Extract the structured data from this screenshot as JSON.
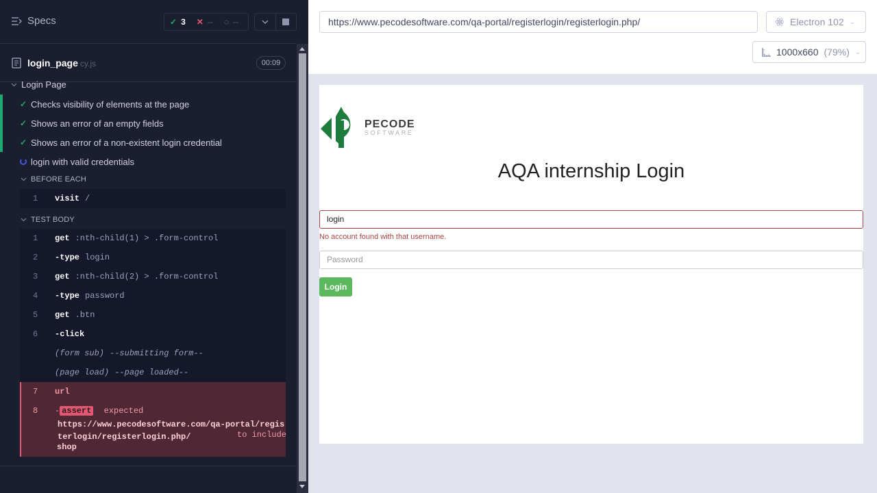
{
  "reporter": {
    "specs_label": "Specs",
    "stats": {
      "passed": "3",
      "failed": "--",
      "pending": "--"
    },
    "spec": {
      "name": "login_page",
      "ext": "cy.js",
      "duration": "00:09"
    },
    "suite_title": "Login Page",
    "tests": [
      {
        "label": "Checks visibility of elements at the page",
        "state": "passed"
      },
      {
        "label": "Shows an error of an empty fields",
        "state": "passed"
      },
      {
        "label": "Shows an error of a non-existent login credential",
        "state": "passed"
      },
      {
        "label": "login with valid credentials",
        "state": "running"
      }
    ],
    "before_each": {
      "title": "BEFORE EACH",
      "commands": [
        {
          "num": "1",
          "name": "visit",
          "msg": "/"
        }
      ]
    },
    "test_body": {
      "title": "TEST BODY",
      "commands": [
        {
          "num": "1",
          "name": "get",
          "msg": ":nth-child(1) > .form-control"
        },
        {
          "num": "2",
          "name": "-type",
          "msg": "login"
        },
        {
          "num": "3",
          "name": "get",
          "msg": ":nth-child(2) > .form-control"
        },
        {
          "num": "4",
          "name": "-type",
          "msg": "password"
        },
        {
          "num": "5",
          "name": "get",
          "msg": ".btn"
        },
        {
          "num": "6",
          "name": "-click",
          "msg": ""
        },
        {
          "num": "",
          "name": "(form sub)",
          "msg": "--submitting form--"
        },
        {
          "num": "",
          "name": "(page load)",
          "msg": "--page loaded--"
        }
      ],
      "error": {
        "url_num": "7",
        "url_name": "url",
        "assert_num": "8",
        "assert_dash": "-",
        "assert_label": "assert",
        "expected": "expected",
        "actual": "https://www.pecodesoftware.com/qa-portal/registerlogin/registerlogin.php/",
        "to_include": "to include",
        "value": "shop"
      }
    }
  },
  "aut": {
    "url": "https://www.pecodesoftware.com/qa-portal/registerlogin/registerlogin.php/",
    "browser": "Electron 102",
    "viewport": "1000x660",
    "zoom": "(79%)",
    "page": {
      "logo_main": "PECODE",
      "logo_sub": "SOFTWARE",
      "title": "AQA internship Login",
      "login_value": "login",
      "error": "No account found with that username.",
      "password_placeholder": "Password",
      "login_button": "Login"
    },
    "colors": {
      "brand_green": "#1e7d3c",
      "button_green": "#5cb85c",
      "error_red": "#a94442",
      "pass_green": "#1fa971",
      "fail_pink": "#e45770"
    }
  }
}
